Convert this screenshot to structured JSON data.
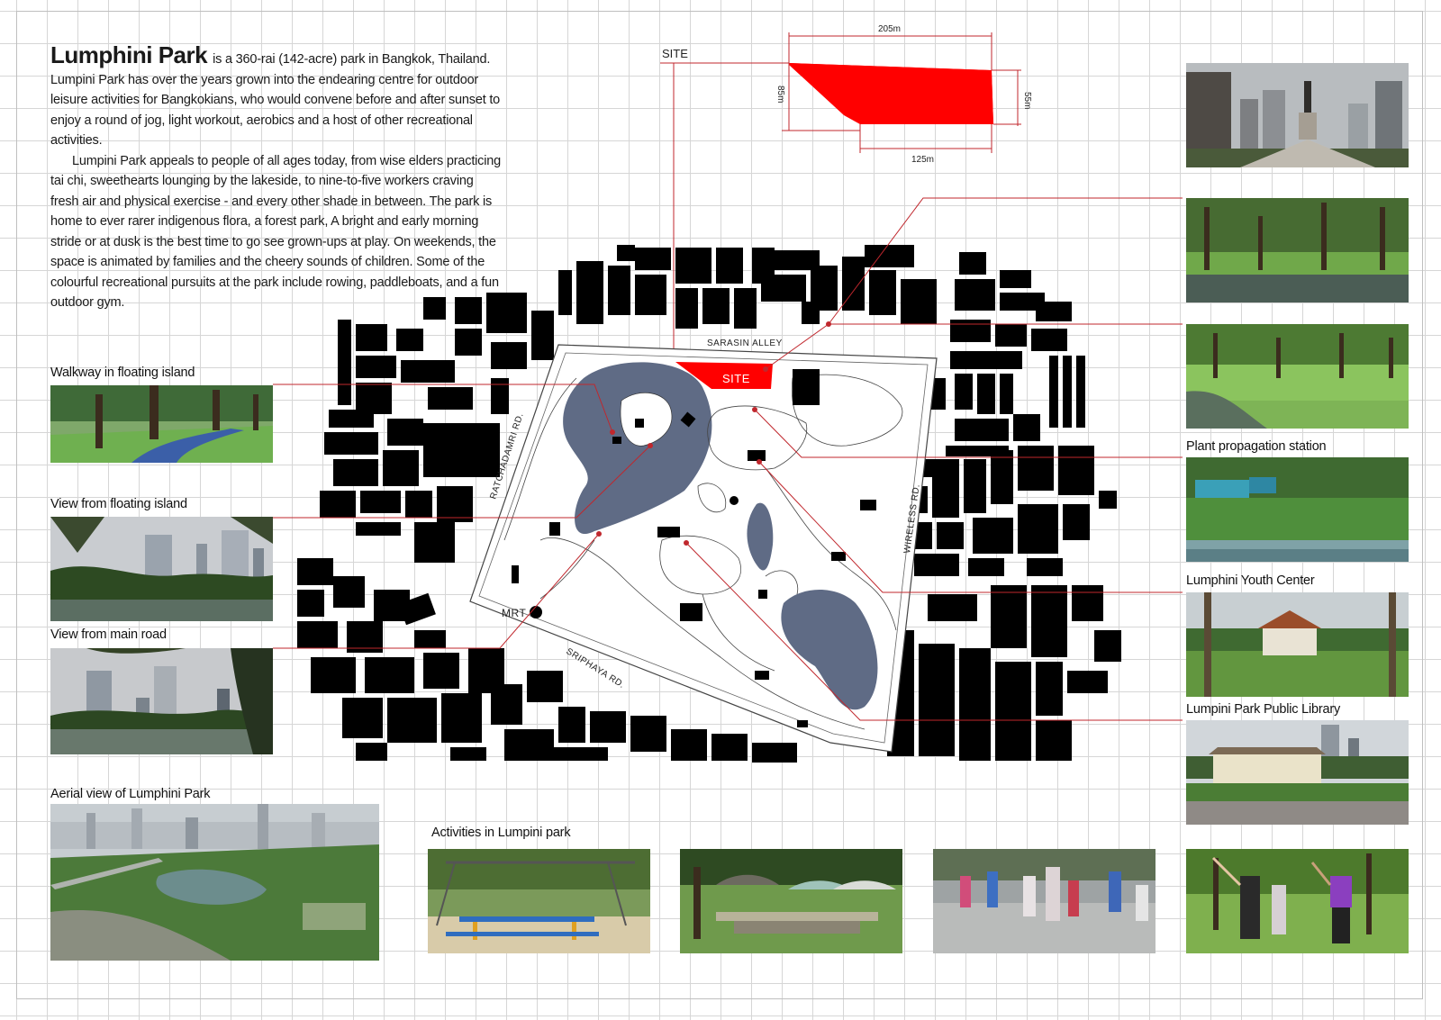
{
  "intro": {
    "title": "Lumphini Park",
    "paragraph1": "is a 360-rai (142-acre) park in Bangkok, Thailand. Lumpini Park has over the years grown into the endearing centre for outdoor leisure activities for Bangkokians, who would convene before and after sunset to enjoy a round of jog, light workout, aerobics and a host of other recreational activities.",
    "paragraph2": "Lumpini Park appeals to people of all ages today, from wise elders practicing tai chi, sweethearts lounging by the lakeside, to nine-to-five workers craving fresh air and physical exercise - and every other shade in between. The park is home to ever rarer indigenous flora, a forest park, A bright and early morning stride or at dusk is the best time to go see grown-ups at play. On weekends, the space is animated by families and the cheery sounds of children. Some of the colourful recreational pursuits at the park include rowing, paddleboats, and a fun outdoor gym."
  },
  "site_diagram": {
    "label": "SITE",
    "dims": {
      "top": "205m",
      "left": "85m",
      "right": "55m",
      "bottom": "125m"
    },
    "fill_color": "#ff0000"
  },
  "map": {
    "site_label": "SITE",
    "mrt_label": "MRT",
    "roads": {
      "north": "SARASIN ALLEY",
      "west": "RATCHADAMRI RD.",
      "east": "WIRELESS RD.",
      "south": "SRIPHAYA RD."
    },
    "colors": {
      "water": "#5f6b85",
      "site": "#ff0000",
      "leader": "#c0272d",
      "building": "#000000"
    }
  },
  "left_captions": {
    "walkway": "Walkway in floating island",
    "view_island": "View from floating island",
    "view_road": "View from main road",
    "aerial": "Aerial view of Lumphini Park"
  },
  "right_captions": {
    "plant": "Plant propagation station",
    "youth": "Lumphini Youth Center",
    "library": "Lumpini Park Public Library"
  },
  "bottom": {
    "activities": "Activities in Lumpini park"
  }
}
